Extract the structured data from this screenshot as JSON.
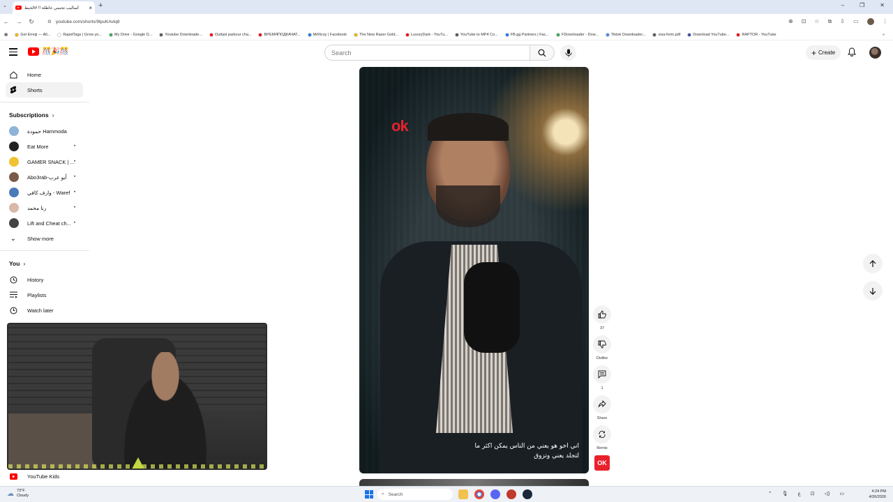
{
  "browser": {
    "tab_title": "أساليب تجنبني خاطلة !! #الخبط",
    "tab_close": "×",
    "new_tab": "+",
    "url": "youtube.com/shorts/9tpuKAvlq8",
    "bookmarks": [
      {
        "label": "Get Emoji — All...",
        "color": "#f4b400"
      },
      {
        "label": "RapidTags | Grow yo...",
        "color": "#ffffff"
      },
      {
        "label": "My Drive - Google D...",
        "color": "#34a853"
      },
      {
        "label": "Youtube Downloade...",
        "color": "#555555"
      },
      {
        "label": "Outlast parkour cha...",
        "color": "#ff0000"
      },
      {
        "label": "ВРЕМЯПОДКАЧАТ...",
        "color": "#ff0000"
      },
      {
        "label": "MrRicsy | Facebook",
        "color": "#1877f2"
      },
      {
        "label": "The New Razer Gold...",
        "color": "#f4b400"
      },
      {
        "label": "LuxuryDark - YouTu...",
        "color": "#ff0000"
      },
      {
        "label": "YouTube to MP4 Co...",
        "color": "#555555"
      },
      {
        "label": "FB.gg Partners | Fac...",
        "color": "#1877f2"
      },
      {
        "label": "FDownloader - Dow...",
        "color": "#34a853"
      },
      {
        "label": "Tiktok Downloader...",
        "color": "#4285f4"
      },
      {
        "label": "visa-form.pdf",
        "color": "#555555"
      },
      {
        "label": "Download YouTube...",
        "color": "#3949ab"
      },
      {
        "label": "RAPTOR - YouTube",
        "color": "#ff0000"
      }
    ],
    "bookmarks_more": "»"
  },
  "header": {
    "doodle": "🎊🎉🎊",
    "search_placeholder": "Search",
    "create_label": "Create"
  },
  "sidebar": {
    "main": [
      {
        "label": "Home",
        "icon": "home-icon"
      },
      {
        "label": "Shorts",
        "icon": "shorts-icon"
      }
    ],
    "subscriptions_title": "Subscriptions",
    "subscriptions": [
      {
        "label": "حمودة Hammoda",
        "color": "#8fb3d9",
        "new": false
      },
      {
        "label": "Eat More",
        "color": "#222222",
        "new": true
      },
      {
        "label": "GAMER SNACK | ...",
        "color": "#f1c232",
        "new": true
      },
      {
        "label": "Abo3rab-أبو عرب",
        "color": "#7a5a48",
        "new": true
      },
      {
        "label": "وارف كافي - Waref",
        "color": "#4a7ab8",
        "new": true
      },
      {
        "label": "رنا محمد",
        "color": "#d9b8a8",
        "new": true
      },
      {
        "label": "Lift and Cheat ch...",
        "color": "#444444",
        "new": true
      }
    ],
    "show_more": "Show more",
    "you_title": "You",
    "you_items": [
      {
        "label": "History",
        "icon": "history-icon"
      },
      {
        "label": "Playlists",
        "icon": "playlists-icon"
      },
      {
        "label": "Watch later",
        "icon": "watch-later-icon"
      }
    ],
    "youtube_kids": "YouTube Kids",
    "new_dot": "•"
  },
  "player": {
    "brand": "ok",
    "caption_line1": "اني اخو هو يعني من الناس يمكن اكثر ما",
    "caption_line2": "لتجلد يعني وتزوق"
  },
  "actions": {
    "like_count": "37",
    "dislike_label": "Dislike",
    "comment_count": "1",
    "share_label": "Share",
    "remix_label": "Remix",
    "channel_badge": "OK"
  },
  "taskbar": {
    "weather_temp": "73°F",
    "weather_desc": "Cloudy",
    "search_placeholder": "Search",
    "time": "4:24 PM",
    "date": "4/26/2026"
  }
}
